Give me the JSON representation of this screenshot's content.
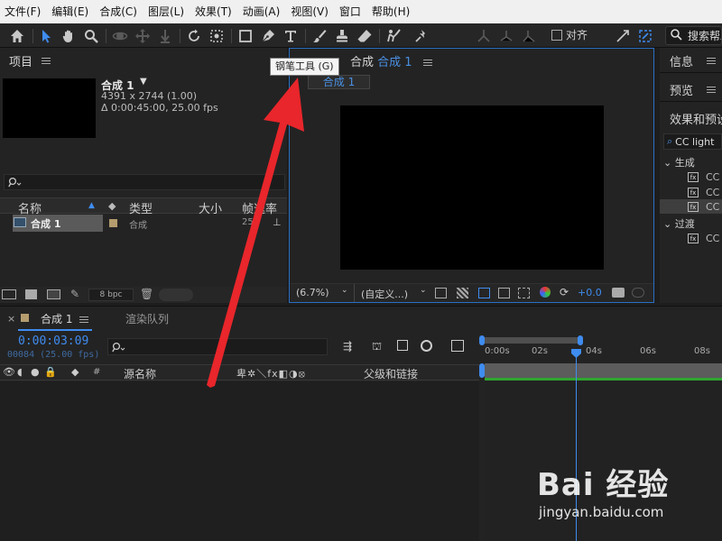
{
  "menu": [
    "文件(F)",
    "编辑(E)",
    "合成(C)",
    "图层(L)",
    "效果(T)",
    "动画(A)",
    "视图(V)",
    "窗口",
    "帮助(H)"
  ],
  "toolbar": {
    "icons": [
      "home-icon",
      "selection-icon",
      "hand-icon",
      "zoom-icon",
      "orbit-icon",
      "pan-icon",
      "dolly-icon",
      "rotate-icon",
      "camera-icon",
      "rectangle-icon",
      "pen-icon",
      "type-icon",
      "brush-icon",
      "clone-stamp-icon",
      "eraser-icon",
      "roto-brush-icon",
      "puppet-pin-icon"
    ],
    "align_label": "对齐",
    "search_help": "搜索帮助"
  },
  "tooltip": "钢笔工具 (G)",
  "project": {
    "title": "项目",
    "comp_name": "合成 1",
    "comp_size": "4391 x 2744 (1.00)",
    "comp_duration": "Δ 0:00:45:00, 25.00 fps",
    "columns": [
      "名称",
      "类型",
      "大小",
      "帧速率"
    ],
    "row": {
      "name": "合成 1",
      "type": "合成",
      "rate": "25"
    },
    "bpc": "8 bpc"
  },
  "composition": {
    "tab_prefix": "合成",
    "tab_name": "合成 1",
    "breadcrumb": "合成 1",
    "zoom": "(6.7%)",
    "resolution": "(自定义...)",
    "exposure": "+0.0"
  },
  "right": {
    "info": "信息",
    "preview": "预览",
    "effects": "效果和预设",
    "search": "CC light",
    "groups": [
      {
        "name": "生成",
        "items": [
          "CC",
          "CC",
          "CC"
        ]
      },
      {
        "name": "过渡",
        "items": [
          "CC"
        ]
      }
    ]
  },
  "timeline": {
    "tab_comp": "合成 1",
    "tab_render": "渲染队列",
    "time": "0:00:03:09",
    "frame": "00084 (25.00 fps)",
    "col_source": "源名称",
    "col_parent": "父级和链接",
    "ticks": [
      "0:00s",
      "02s",
      "04s",
      "06s",
      "08s"
    ]
  },
  "watermark": {
    "logo": "Bai 经验",
    "url": "jingyan.baidu.com"
  },
  "colors": {
    "accent": "#3f8cf0",
    "annotation": "#e8262b",
    "panel": "#232323"
  }
}
